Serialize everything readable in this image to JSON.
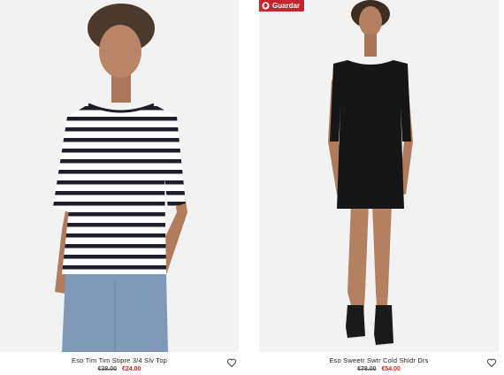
{
  "products": [
    {
      "name": "Eso Tim Tim Stipre 3/4 Slv Top",
      "old_price": "€38.00",
      "new_price": "€24.00",
      "image": "model-striped-top"
    },
    {
      "name": "Eso Sweetr Swtr Cold Shldr Drs",
      "old_price": "€78.00",
      "new_price": "€54.00",
      "image": "model-black-dress"
    }
  ],
  "pinterest": {
    "label": "Guardar"
  },
  "colors": {
    "sale": "#e2231a",
    "pinterest": "#c8232c",
    "background": "#f2f2f2"
  }
}
